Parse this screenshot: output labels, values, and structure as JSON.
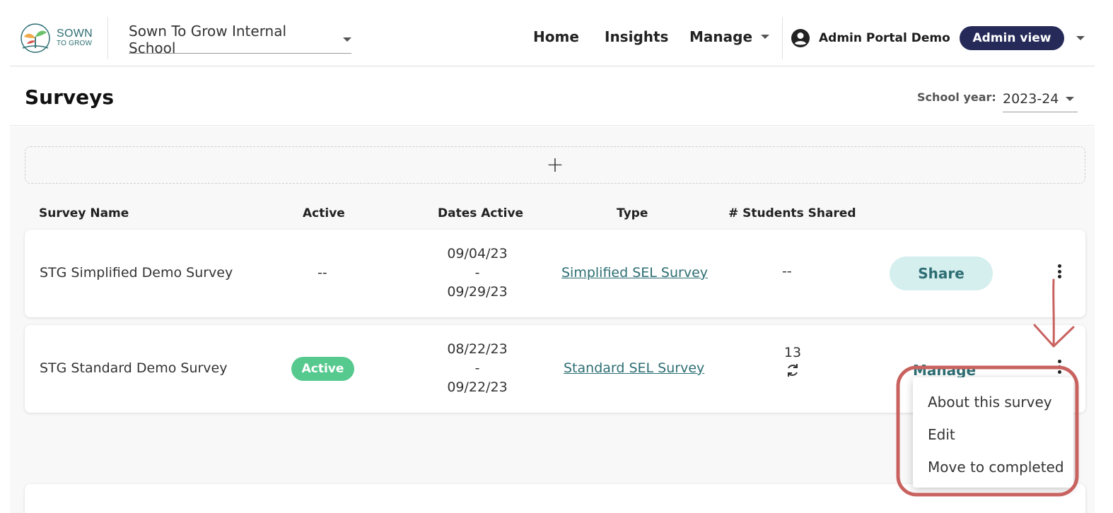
{
  "brand": {
    "logo_line1": "SOWN",
    "logo_line2": "TO GROW",
    "colors": {
      "teal": "#2d6e73",
      "navy": "#252a59",
      "green": "#56c98e",
      "annotation_red": "#c8625f"
    }
  },
  "header": {
    "school_select": "Sown To Grow Internal School",
    "nav": {
      "home": "Home",
      "insights": "Insights",
      "manage": "Manage"
    },
    "user_name": "Admin Portal Demo",
    "admin_view": "Admin view",
    "icons": {
      "user": "account-circle-icon",
      "caret": "caret-down-icon"
    }
  },
  "page": {
    "title": "Surveys",
    "school_year_label": "School year:",
    "school_year_value": "2023-24"
  },
  "add_button": "+",
  "table": {
    "headers": {
      "name": "Survey Name",
      "active": "Active",
      "dates": "Dates Active",
      "type": "Type",
      "students": "# Students Shared"
    },
    "rows": [
      {
        "name": "STG Simplified Demo Survey",
        "active": "--",
        "date_start": "09/04/23",
        "date_sep": "-",
        "date_end": "09/29/23",
        "type": "Simplified SEL Survey",
        "students": "--",
        "action": "Share"
      },
      {
        "name": "STG Standard Demo Survey",
        "active": "Active",
        "date_start": "08/22/23",
        "date_sep": "-",
        "date_end": "09/22/23",
        "type": "Standard SEL Survey",
        "students": "13",
        "action": "Manage",
        "students_icon": "sync-icon"
      }
    ]
  },
  "menu": {
    "items": [
      "About this survey",
      "Edit",
      "Move to completed"
    ]
  }
}
